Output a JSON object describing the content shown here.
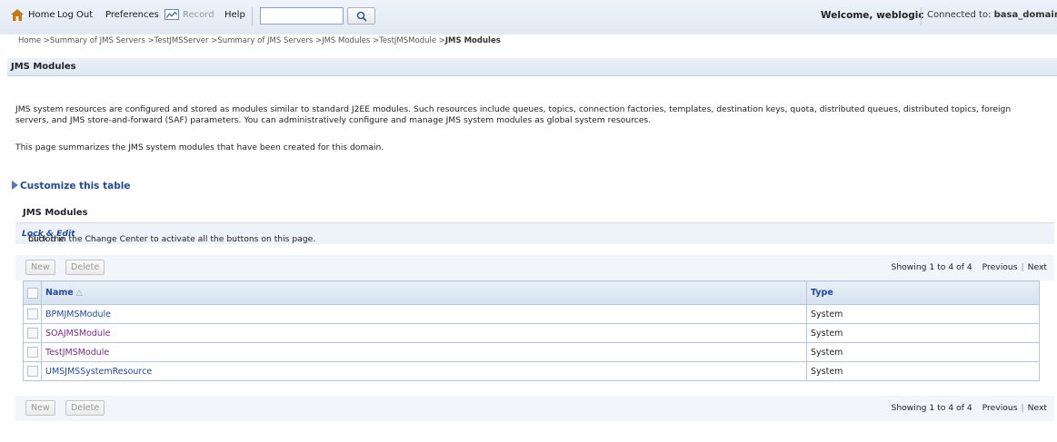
{
  "toolbar": {
    "home": "Home",
    "logout": "Log Out",
    "preferences": "Preferences",
    "record": "Record",
    "help": "Help",
    "search_value": "",
    "welcome": "Welcome, weblogic",
    "connected_label": "Connected to:",
    "connected_domain": "basa_domain"
  },
  "breadcrumb": {
    "trail": "Home >Summary of JMS Servers >TestJMSServer >Summary of JMS Servers >JMS Modules >TestJMSModule >",
    "current": "JMS Modules"
  },
  "page": {
    "title": "JMS Modules",
    "description": "JMS system resources are configured and stored as modules similar to standard J2EE modules. Such resources include queues, topics, connection factories, templates, destination keys, quota, distributed queues, distributed topics, foreign servers, and JMS store-and-forward (SAF) parameters. You can administratively configure and manage JMS system modules as global system resources.",
    "summary": "This page summarizes the JMS system modules that have been created for this domain.",
    "customize": "Customize this table"
  },
  "table_section": {
    "title": "JMS Modules",
    "info_prefix": "Click the ",
    "info_emph": "Lock & Edit",
    "info_suffix": " button in the Change Center to activate all the buttons on this page.",
    "new_label": "New",
    "delete_label": "Delete",
    "showing": "Showing 1 to 4 of 4",
    "previous": "Previous",
    "next": "Next",
    "columns": [
      "Name",
      "Type"
    ],
    "rows": [
      {
        "name": "BPMJMSModule",
        "type": "System"
      },
      {
        "name": "SOAJMSModule",
        "type": "System"
      },
      {
        "name": "TestJMSModule",
        "type": "System"
      },
      {
        "name": "UMSJMSSystemResource",
        "type": "System"
      }
    ]
  }
}
